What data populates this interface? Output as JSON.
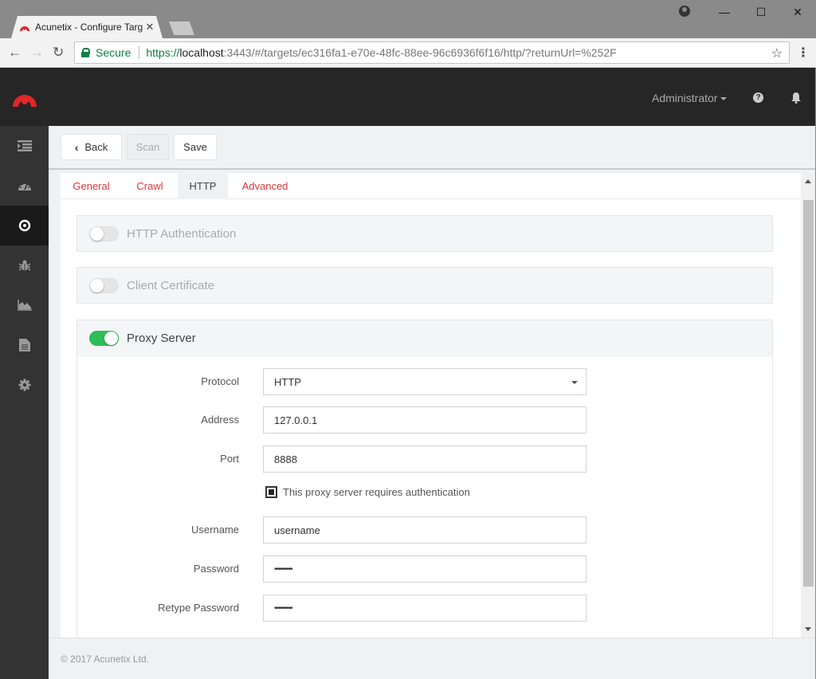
{
  "browser": {
    "tab_title": "Acunetix - Configure Targ",
    "secure_label": "Secure",
    "url_scheme": "https://",
    "url_host": "localhost",
    "url_rest": ":3443/#/targets/ec316fa1-e70e-48fc-88ee-96c6936f6f16/http/?returnUrl=%252F",
    "window_controls": {
      "minimize": "—",
      "maximize": "☐",
      "close": "✕"
    }
  },
  "header": {
    "user": "Administrator",
    "help_glyph": "?"
  },
  "sidebar": {
    "items": [
      {
        "name": "menu-toggle",
        "icon": "list-indent-icon",
        "active": false
      },
      {
        "name": "dashboard",
        "icon": "dashboard-icon",
        "active": false
      },
      {
        "name": "targets",
        "icon": "target-icon",
        "active": true
      },
      {
        "name": "vulnerabilities",
        "icon": "bug-icon",
        "active": false
      },
      {
        "name": "scans",
        "icon": "area-chart-icon",
        "active": false
      },
      {
        "name": "reports",
        "icon": "document-icon",
        "active": false
      },
      {
        "name": "settings",
        "icon": "gear-icon",
        "active": false
      }
    ]
  },
  "actions": {
    "back": "Back",
    "scan": "Scan",
    "save": "Save"
  },
  "tabs": [
    {
      "label": "General",
      "active": false
    },
    {
      "label": "Crawl",
      "active": false
    },
    {
      "label": "HTTP",
      "active": true
    },
    {
      "label": "Advanced",
      "active": false
    }
  ],
  "panels": {
    "http_auth": {
      "title": "HTTP Authentication",
      "enabled": false
    },
    "client_cert": {
      "title": "Client Certificate",
      "enabled": false
    },
    "proxy": {
      "title": "Proxy Server",
      "enabled": true,
      "fields": {
        "protocol": {
          "label": "Protocol",
          "value": "HTTP"
        },
        "address": {
          "label": "Address",
          "value": "127.0.0.1"
        },
        "port": {
          "label": "Port",
          "value": "8888"
        },
        "requires_auth": {
          "label": "This proxy server requires authentication",
          "checked": true
        },
        "username": {
          "label": "Username",
          "value": "username"
        },
        "password": {
          "label": "Password",
          "value": "•••••••••"
        },
        "retype_password": {
          "label": "Retype Password",
          "value": "•••••••••"
        }
      }
    }
  },
  "footer": {
    "copyright": "© 2017 Acunetix Ltd."
  },
  "colors": {
    "brand_red": "#e2262a",
    "tab_link_red": "#d9383a",
    "toggle_on": "#2ebd59",
    "header_bg": "#262626",
    "sidebar_bg": "#333333"
  }
}
